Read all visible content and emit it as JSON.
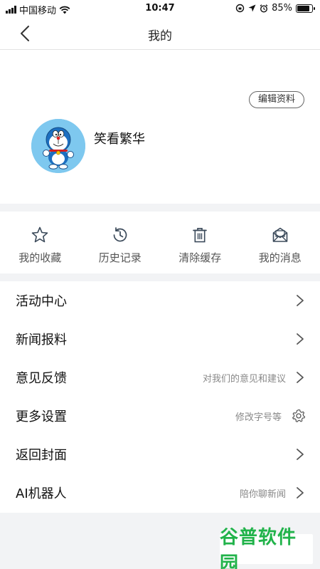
{
  "status_bar": {
    "carrier": "中国移动",
    "time": "10:47",
    "battery": "85%",
    "battery_level": 0.85
  },
  "nav": {
    "title": "我的",
    "back_icon": "chevron-left-icon"
  },
  "profile": {
    "edit_label": "编辑资料",
    "username": "笑看繁华",
    "avatar_icon": "doraemon-avatar"
  },
  "quick_actions": [
    {
      "label": "我的收藏",
      "icon": "star-icon"
    },
    {
      "label": "历史记录",
      "icon": "history-icon"
    },
    {
      "label": "清除缓存",
      "icon": "trash-icon"
    },
    {
      "label": "我的消息",
      "icon": "mail-icon"
    }
  ],
  "menu": [
    {
      "label": "活动中心",
      "hint": ""
    },
    {
      "label": "新闻报料",
      "hint": ""
    },
    {
      "label": "意见反馈",
      "hint": "对我们的意见和建议"
    },
    {
      "label": "更多设置",
      "hint": "修改字号等"
    },
    {
      "label": "返回封面",
      "hint": ""
    },
    {
      "label": "AI机器人",
      "hint": "陪你聊新闻"
    }
  ],
  "watermark": {
    "text": "谷普软件园"
  },
  "colors": {
    "background": "#f2f3f5",
    "avatar_bg": "#7ec8ef",
    "watermark_green": "#21b34a"
  }
}
